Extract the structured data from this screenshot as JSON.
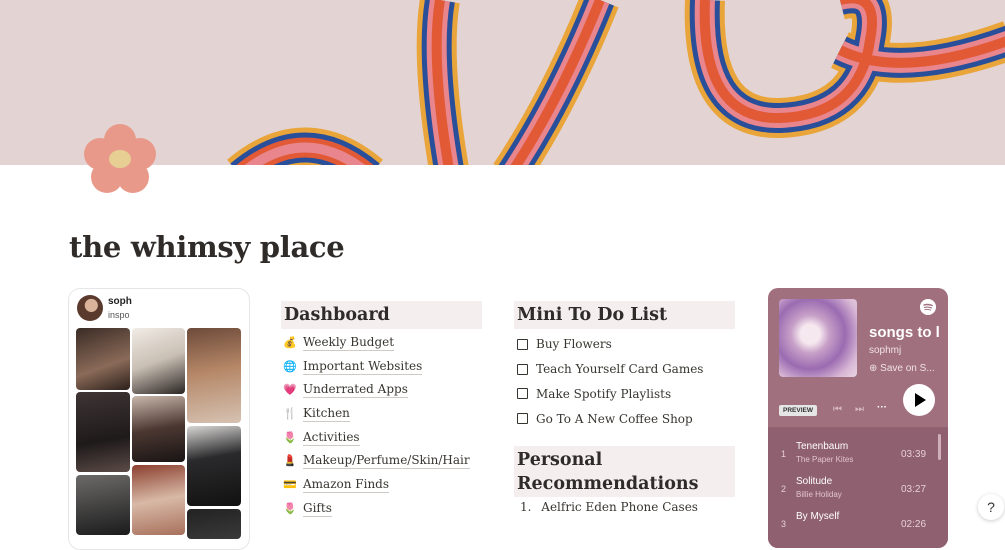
{
  "page": {
    "title": "the whimsy place"
  },
  "cover": {
    "background": "#e3d4d3",
    "stripe_colors": [
      "#e9a43a",
      "#e8858d",
      "#e15a35",
      "#2a4f9a"
    ]
  },
  "pinterest": {
    "username": "soph",
    "board": "inspo"
  },
  "dashboard": {
    "heading": "Dashboard",
    "items": [
      {
        "icon": "money-bag-icon",
        "emoji": "💰",
        "label": "Weekly Budget"
      },
      {
        "icon": "globe-icon",
        "emoji": "🌐",
        "label": "Important Websites"
      },
      {
        "icon": "heart-icon",
        "emoji": "💗",
        "label": "Underrated Apps"
      },
      {
        "icon": "fork-knife-icon",
        "emoji": "🍴",
        "label": "Kitchen"
      },
      {
        "icon": "tulip-icon",
        "emoji": "🌷",
        "label": "Activities"
      },
      {
        "icon": "lipstick-icon",
        "emoji": "💄",
        "label": "Makeup/Perfume/Skin/Hair"
      },
      {
        "icon": "credit-card-icon",
        "emoji": "💳",
        "label": "Amazon Finds"
      },
      {
        "icon": "tulip-icon",
        "emoji": "🌷",
        "label": "Gifts"
      }
    ]
  },
  "todo": {
    "heading": "Mini To Do List",
    "items": [
      "Buy Flowers",
      "Teach Yourself Card Games",
      "Make Spotify Playlists",
      "Go To A New Coffee Shop"
    ]
  },
  "recommendations": {
    "heading_line1": "Personal",
    "heading_line2": "Recommendations",
    "items": [
      {
        "num": "1.",
        "label": "Aelfric Eden Phone Cases"
      }
    ]
  },
  "spotify": {
    "playlist_title": "songs to l",
    "owner": "sophmj",
    "save_label": "Save on S...",
    "preview_label": "PREVIEW",
    "tracks": [
      {
        "num": "1",
        "title": "Tenenbaum",
        "artist": "The Paper Kites",
        "duration": "03:39"
      },
      {
        "num": "2",
        "title": "Solitude",
        "artist": "Billie Holiday",
        "duration": "03:27"
      },
      {
        "num": "3",
        "title": "By Myself",
        "artist": "",
        "duration": "02:26"
      }
    ]
  },
  "help": {
    "label": "?"
  }
}
